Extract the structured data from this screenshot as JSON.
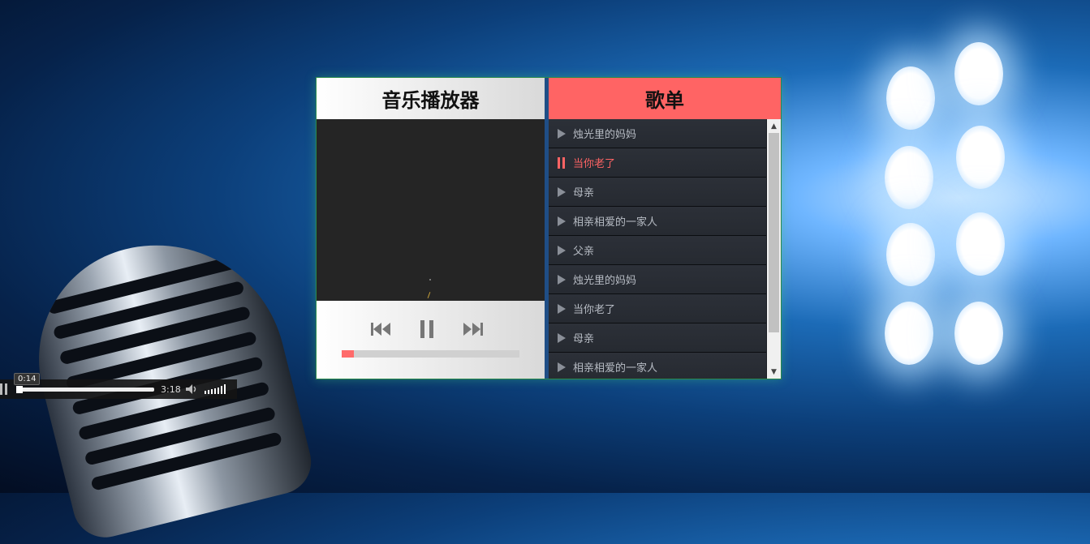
{
  "player": {
    "title": "音乐播放器",
    "progress_fraction": 0.07,
    "accent_color": "#ff6464",
    "controls": {
      "prev_icon": "skip-previous-icon",
      "pause_icon": "pause-icon",
      "next_icon": "skip-next-icon"
    }
  },
  "playlist": {
    "title": "歌单",
    "items": [
      {
        "label": "烛光里的妈妈",
        "state": "play"
      },
      {
        "label": "当你老了",
        "state": "playing"
      },
      {
        "label": "母亲",
        "state": "play"
      },
      {
        "label": "相亲相爱的一家人",
        "state": "play"
      },
      {
        "label": "父亲",
        "state": "play"
      },
      {
        "label": "烛光里的妈妈",
        "state": "play"
      },
      {
        "label": "当你老了",
        "state": "play"
      },
      {
        "label": "母亲",
        "state": "play"
      },
      {
        "label": "相亲相爱的一家人",
        "state": "play"
      }
    ]
  },
  "media_bar": {
    "current_time": "0:14",
    "duration": "3:18"
  }
}
